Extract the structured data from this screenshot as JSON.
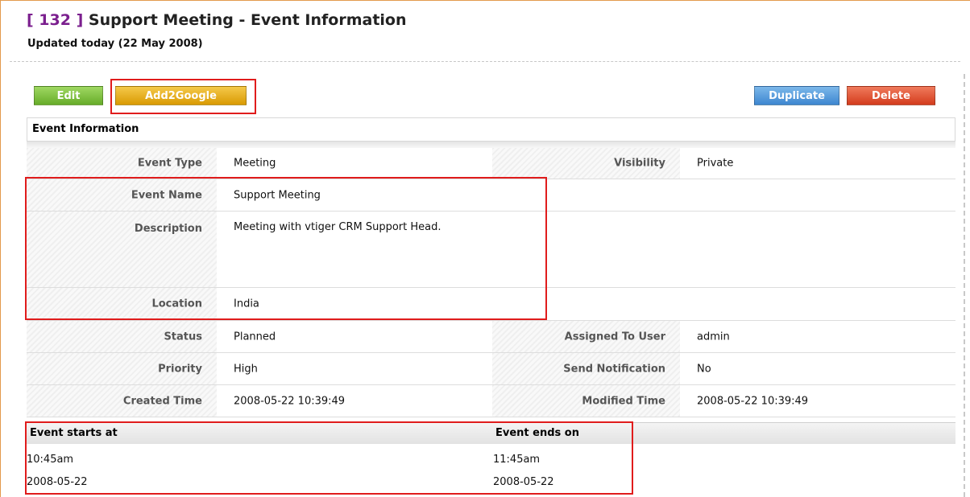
{
  "header": {
    "record_id": "[ 132 ]",
    "title": "Support Meeting - Event Information",
    "updated": "Updated today (22 May 2008)"
  },
  "buttons": {
    "edit": "Edit",
    "add2google": "Add2Google",
    "duplicate": "Duplicate",
    "delete": "Delete"
  },
  "section": {
    "title": "Event Information"
  },
  "fields": {
    "event_type": {
      "label": "Event Type",
      "value": "Meeting"
    },
    "visibility": {
      "label": "Visibility",
      "value": "Private"
    },
    "event_name": {
      "label": "Event Name",
      "value": "Support Meeting"
    },
    "description": {
      "label": "Description",
      "value": "Meeting with vtiger CRM Support Head."
    },
    "location": {
      "label": "Location",
      "value": "India"
    },
    "status": {
      "label": "Status",
      "value": "Planned"
    },
    "assigned_to": {
      "label": "Assigned To User",
      "value": "admin"
    },
    "priority": {
      "label": "Priority",
      "value": "High"
    },
    "send_notification": {
      "label": "Send Notification",
      "value": "No"
    },
    "created_time": {
      "label": "Created Time",
      "value": "2008-05-22 10:39:49"
    },
    "modified_time": {
      "label": "Modified Time",
      "value": "2008-05-22 10:39:49"
    }
  },
  "times": {
    "starts_label": "Event starts at",
    "ends_label": "Event ends on",
    "start_time": "10:45am",
    "start_date": "2008-05-22",
    "end_time": "11:45am",
    "end_date": "2008-05-22"
  },
  "colors": {
    "record_id": "#7b1f8e",
    "edit_button": "#67ac29",
    "google_button": "#d99a03",
    "duplicate_button": "#3d86d0",
    "delete_button": "#d33c1d",
    "highlight_box": "#e01c1c"
  }
}
